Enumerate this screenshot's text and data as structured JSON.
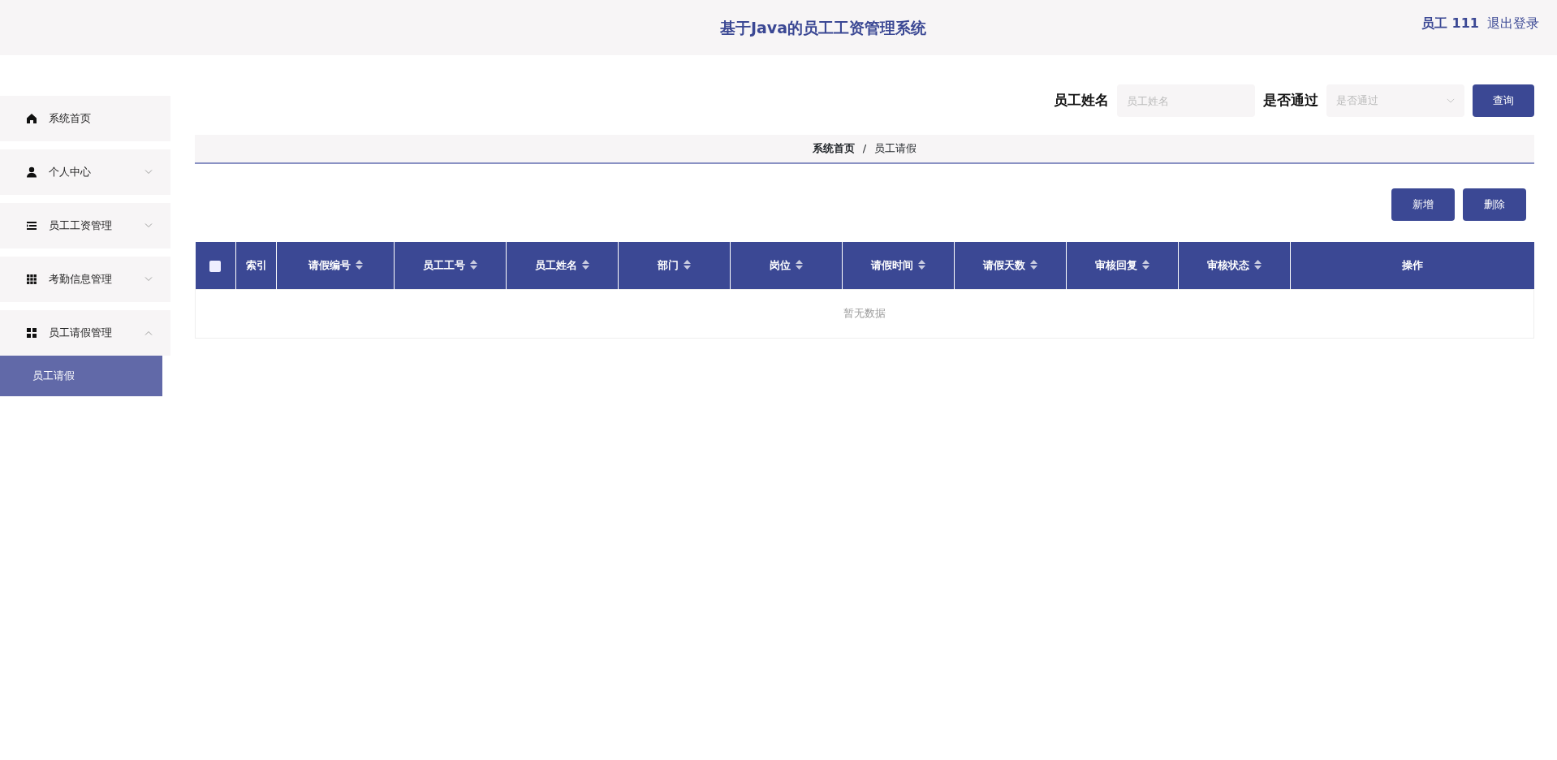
{
  "header": {
    "title": "基于Java的员工工资管理系统",
    "user": "员工 111",
    "logout": "退出登录"
  },
  "sidebar": {
    "items": [
      {
        "label": "系统首页",
        "kind": "link"
      },
      {
        "label": "个人中心",
        "kind": "menu",
        "expanded": false
      },
      {
        "label": "员工工资管理",
        "kind": "menu",
        "expanded": false
      },
      {
        "label": "考勤信息管理",
        "kind": "menu",
        "expanded": false
      },
      {
        "label": "员工请假管理",
        "kind": "menu",
        "expanded": true,
        "children": [
          {
            "label": "员工请假",
            "selected": true
          }
        ]
      }
    ]
  },
  "search": {
    "fields": [
      {
        "label": "员工姓名",
        "placeholder": "员工姓名",
        "kind": "text"
      },
      {
        "label": "是否通过",
        "placeholder": "是否通过",
        "kind": "select"
      }
    ],
    "button": "查询"
  },
  "breadcrumb": {
    "separator": "/",
    "items": [
      "系统首页",
      "员工请假"
    ]
  },
  "actions": [
    "新增",
    "删除"
  ],
  "table": {
    "select_all": {
      "checked": false
    },
    "columns": [
      {
        "label": "索引",
        "sortable": false
      },
      {
        "label": "请假编号",
        "sortable": true
      },
      {
        "label": "员工工号",
        "sortable": true
      },
      {
        "label": "员工姓名",
        "sortable": true
      },
      {
        "label": "部门",
        "sortable": true
      },
      {
        "label": "岗位",
        "sortable": true
      },
      {
        "label": "请假时间",
        "sortable": true
      },
      {
        "label": "请假天数",
        "sortable": true
      },
      {
        "label": "审核回复",
        "sortable": true
      },
      {
        "label": "审核状态",
        "sortable": true
      },
      {
        "label": "操作",
        "sortable": false
      }
    ],
    "empty_text": "暂无数据"
  }
}
